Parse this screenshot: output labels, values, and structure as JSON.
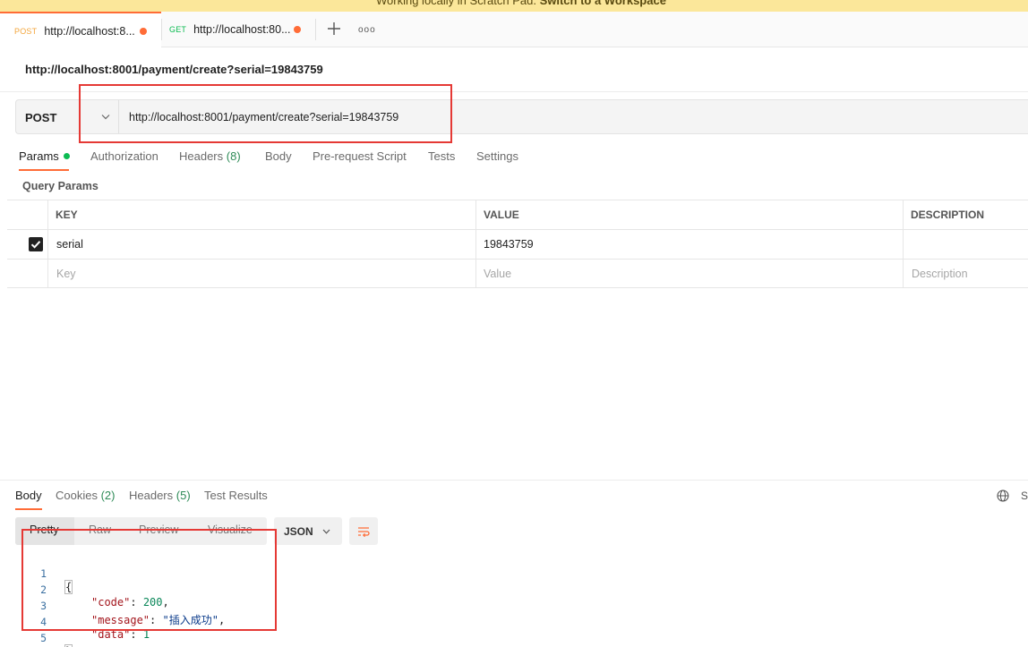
{
  "banner": {
    "prefix": "Working locally in Scratch Pad.",
    "link": "Switch to a Workspace"
  },
  "tabs": [
    {
      "method": "POST",
      "method_color": "#f3a63d",
      "title": "http://localhost:8...",
      "dirty_color": "#ff6c37"
    },
    {
      "method": "GET",
      "method_color": "#0cbb52",
      "title": "http://localhost:80...",
      "dirty_color": "#ff6c37"
    }
  ],
  "tab_actions": {
    "more_label": "ooo"
  },
  "request": {
    "title": "http://localhost:8001/payment/create?serial=19843759",
    "method": "POST",
    "url": "http://localhost:8001/payment/create?serial=19843759"
  },
  "request_tabs": [
    {
      "label": "Params"
    },
    {
      "label": "Authorization"
    },
    {
      "label": "Headers",
      "count": "(8)"
    },
    {
      "label": "Body"
    },
    {
      "label": "Pre-request Script"
    },
    {
      "label": "Tests"
    },
    {
      "label": "Settings"
    }
  ],
  "query_params": {
    "label": "Query Params",
    "columns": [
      "KEY",
      "VALUE",
      "DESCRIPTION"
    ],
    "rows": [
      {
        "checked": true,
        "key": "serial",
        "value": "19843759",
        "description": ""
      }
    ],
    "placeholders": {
      "key": "Key",
      "value": "Value",
      "description": "Description"
    }
  },
  "response_tabs": [
    {
      "label": "Body"
    },
    {
      "label": "Cookies",
      "count": "(2)"
    },
    {
      "label": "Headers",
      "count": "(5)"
    },
    {
      "label": "Test Results"
    }
  ],
  "response_status_partial": "S",
  "view_modes": [
    "Pretty",
    "Raw",
    "Preview",
    "Visualize"
  ],
  "format": "JSON",
  "body_lines": [
    {
      "n": "1",
      "text": "{"
    },
    {
      "n": "2",
      "key": "\"code\"",
      "num": "200",
      "tail": ","
    },
    {
      "n": "3",
      "key": "\"message\"",
      "str": "\"插入成功\"",
      "tail": ","
    },
    {
      "n": "4",
      "key": "\"data\"",
      "num": "1"
    },
    {
      "n": "5",
      "text": "}"
    }
  ],
  "colors": {
    "accent": "#ff6c37",
    "highlight": "#e53935",
    "success": "#0cbb52"
  }
}
